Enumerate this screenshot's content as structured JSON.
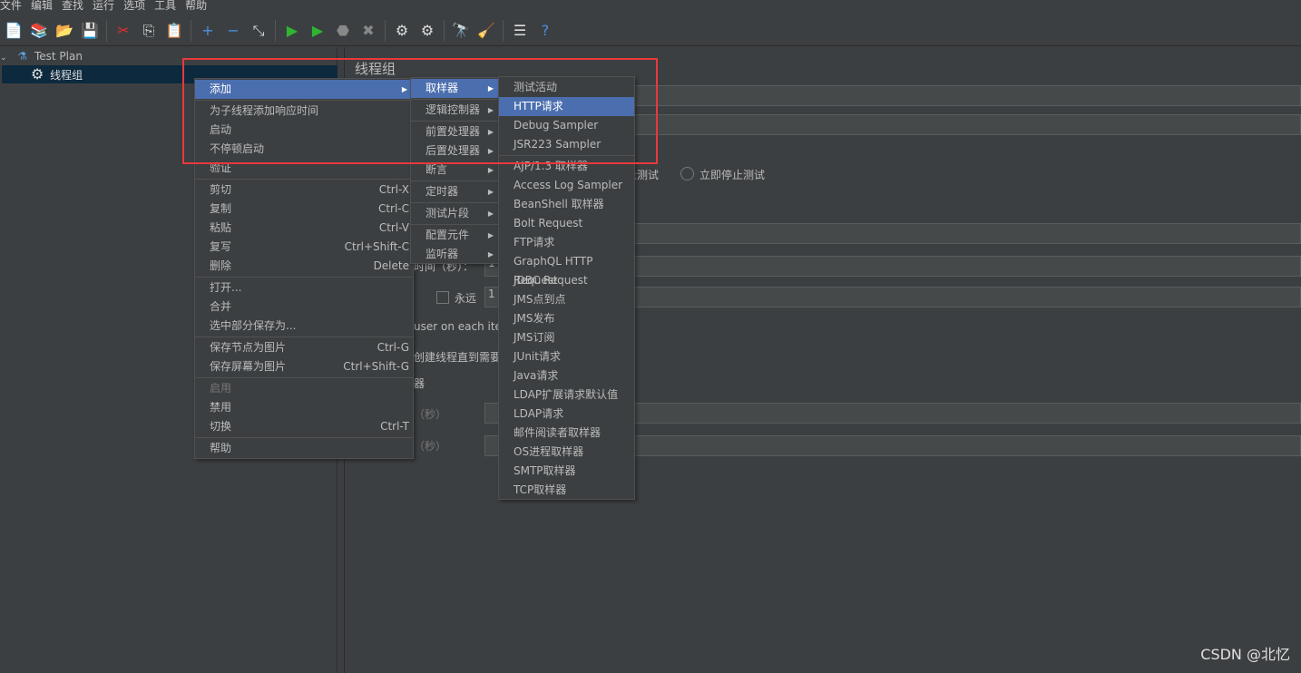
{
  "menubar": [
    "文件",
    "编辑",
    "查找",
    "运行",
    "选项",
    "工具",
    "帮助"
  ],
  "toolbar": [
    {
      "name": "new-icon",
      "g": "📄"
    },
    {
      "name": "templates-icon",
      "g": "📚"
    },
    {
      "name": "open-icon",
      "g": "📂"
    },
    {
      "name": "save-icon",
      "g": "💾"
    },
    "sep",
    {
      "name": "cut-icon",
      "g": "✂"
    },
    {
      "name": "copy-icon",
      "g": "⎘"
    },
    {
      "name": "paste-icon",
      "g": "📋"
    },
    "sep",
    {
      "name": "expand-icon",
      "g": "+"
    },
    {
      "name": "collapse-icon",
      "g": "−"
    },
    {
      "name": "toggle-icon",
      "g": "⤡"
    },
    "sep",
    {
      "name": "start-icon",
      "g": "▶"
    },
    {
      "name": "start-no-pause-icon",
      "g": "▶"
    },
    {
      "name": "stop-icon",
      "g": "⬣"
    },
    {
      "name": "shutdown-icon",
      "g": "✖"
    },
    "sep",
    {
      "name": "clear-icon",
      "g": "⚙"
    },
    {
      "name": "clear-all-icon",
      "g": "⚙"
    },
    "sep",
    {
      "name": "search-icon",
      "g": "🔭"
    },
    {
      "name": "reset-search-icon",
      "g": "🧹"
    },
    "sep",
    {
      "name": "function-helper-icon",
      "g": "☰"
    },
    {
      "name": "help-icon",
      "g": "?"
    }
  ],
  "tree": {
    "root": "Test Plan",
    "child": "线程组"
  },
  "panel": {
    "title": "线程组",
    "stop_test": "止测试",
    "stop_now": "立即停止测试",
    "ramp": "时间（秒）：",
    "ramp_val": "1",
    "forever": "永远",
    "loop_val": "1",
    "same_user": "user on each itera",
    "delay": "创建线程直到需要",
    "scheduler": "器",
    "duration": "（秒）",
    "startup_delay": "（秒）"
  },
  "context_menu": {
    "items": [
      {
        "label": "添加",
        "submenu": true,
        "highlighted": true
      },
      "sep",
      {
        "label": "为子线程添加响应时间"
      },
      {
        "label": "启动"
      },
      {
        "label": "不停顿启动"
      },
      {
        "label": "验证"
      },
      "sep",
      {
        "label": "剪切",
        "shortcut": "Ctrl-X"
      },
      {
        "label": "复制",
        "shortcut": "Ctrl-C"
      },
      {
        "label": "粘贴",
        "shortcut": "Ctrl-V"
      },
      {
        "label": "复写",
        "shortcut": "Ctrl+Shift-C"
      },
      {
        "label": "删除",
        "shortcut": "Delete"
      },
      "sep",
      {
        "label": "打开..."
      },
      {
        "label": "合并"
      },
      {
        "label": "选中部分保存为..."
      },
      "sep",
      {
        "label": "保存节点为图片",
        "shortcut": "Ctrl-G"
      },
      {
        "label": "保存屏幕为图片",
        "shortcut": "Ctrl+Shift-G"
      },
      "sep",
      {
        "label": "启用",
        "disabled": true
      },
      {
        "label": "禁用"
      },
      {
        "label": "切换",
        "shortcut": "Ctrl-T"
      },
      "sep",
      {
        "label": "帮助"
      }
    ]
  },
  "add_menu": {
    "items": [
      {
        "label": "取样器",
        "highlighted": true
      },
      "sep",
      {
        "label": "逻辑控制器"
      },
      "sep",
      {
        "label": "前置处理器"
      },
      {
        "label": "后置处理器"
      },
      {
        "label": "断言"
      },
      "sep",
      {
        "label": "定时器"
      },
      "sep",
      {
        "label": "测试片段"
      },
      "sep",
      {
        "label": "配置元件"
      },
      {
        "label": "监听器"
      }
    ]
  },
  "sampler_menu": {
    "items": [
      {
        "label": "测试活动"
      },
      {
        "label": "HTTP请求",
        "highlighted": true
      },
      {
        "label": "Debug Sampler"
      },
      {
        "label": "JSR223 Sampler"
      },
      "sep",
      {
        "label": "AJP/1.3 取样器"
      },
      {
        "label": "Access Log Sampler"
      },
      {
        "label": "BeanShell 取样器"
      },
      {
        "label": "Bolt Request"
      },
      {
        "label": "FTP请求"
      },
      {
        "label": "GraphQL HTTP Request"
      },
      {
        "label": "JDBC Request"
      },
      {
        "label": "JMS点到点"
      },
      {
        "label": "JMS发布"
      },
      {
        "label": "JMS订阅"
      },
      {
        "label": "JUnit请求"
      },
      {
        "label": "Java请求"
      },
      {
        "label": "LDAP扩展请求默认值"
      },
      {
        "label": "LDAP请求"
      },
      {
        "label": "邮件阅读者取样器"
      },
      {
        "label": "OS进程取样器"
      },
      {
        "label": "SMTP取样器"
      },
      {
        "label": "TCP取样器"
      }
    ]
  },
  "watermark": "CSDN @北忆",
  "colors": {
    "background": "#3c3f41",
    "highlight": "#4b6eaf",
    "annotation": "#e8393b"
  }
}
